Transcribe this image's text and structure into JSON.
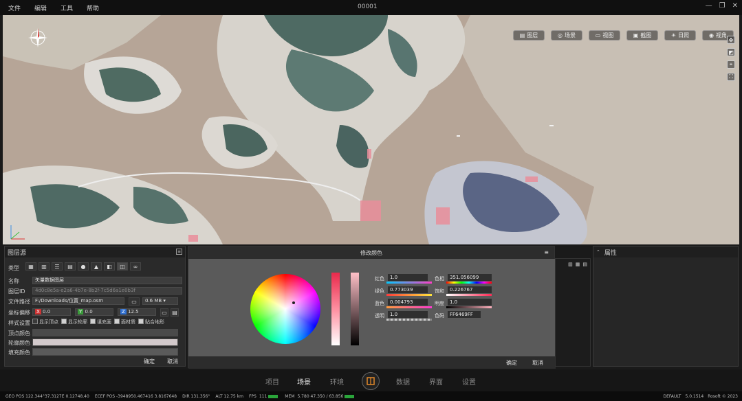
{
  "menu": [
    "文件",
    "编辑",
    "工具",
    "帮助"
  ],
  "window_title": "00001",
  "window_controls": [
    "—",
    "❐",
    "✕"
  ],
  "map_toolbar": [
    {
      "label": "图层",
      "icon": "layers-icon"
    },
    {
      "label": "场景",
      "icon": "scene-icon"
    },
    {
      "label": "视图",
      "icon": "view-icon"
    },
    {
      "label": "截图",
      "icon": "screenshot-icon"
    },
    {
      "label": "日照",
      "icon": "sun-icon"
    },
    {
      "label": "视角",
      "icon": "eye-icon"
    }
  ],
  "layer_panel": {
    "title": "图层源",
    "tab_label": "类型",
    "fields": {
      "name_label": "名称",
      "name_value": "矢量数据图层",
      "id_label": "图层ID",
      "id_value": "4d0c8e5a-e2a6-4b7e-8b2f-7c5d6a1e0b3f",
      "path_label": "文件路径",
      "path_value": "F:/Downloads/位置_map.osm",
      "size_value": "0.6 MB",
      "coord_label": "坐标偏移",
      "coord_x_tag": "X",
      "coord_x": "0.0",
      "coord_y_tag": "Y",
      "coord_y": "0.0",
      "coord_z_tag": "Z",
      "coord_z": "12.5",
      "style_label": "样式设置",
      "style_options": [
        {
          "label": "显示顶点",
          "checked": false
        },
        {
          "label": "显示轮廓",
          "checked": true
        },
        {
          "label": "填充面",
          "checked": true
        },
        {
          "label": "面材质",
          "checked": true
        },
        {
          "label": "贴合地形",
          "checked": true
        }
      ],
      "vertex_color_label": "顶点颜色",
      "outline_color_label": "轮廓颜色",
      "fill_color_label": "填充颜色"
    },
    "confirm": "确定",
    "cancel": "取消"
  },
  "color_dialog": {
    "title": "修改颜色",
    "rows_left": [
      {
        "label": "红色",
        "value": "1.0"
      },
      {
        "label": "绿色",
        "value": "0.773039"
      },
      {
        "label": "蓝色",
        "value": "0.004793"
      },
      {
        "label": "透明",
        "value": "1.0"
      }
    ],
    "rows_right": [
      {
        "label": "色相",
        "value": "351.056099"
      },
      {
        "label": "饱和",
        "value": "0.226767"
      },
      {
        "label": "明度",
        "value": "1.0"
      },
      {
        "label": "色码",
        "value": "FF6469FF"
      }
    ],
    "confirm": "确定",
    "cancel": "取消"
  },
  "props_panel": {
    "title": "属性"
  },
  "bottom_nav": {
    "items": [
      "项目",
      "场景",
      "环境",
      "数据",
      "界面",
      "设置"
    ],
    "active": "场景"
  },
  "status": {
    "geo": "GEO POS 122.344°37.3127E 0.12748.40",
    "ecef": "ECEF POS -3948950.467416 3.8167648",
    "dir": "DIR  131.356°",
    "alt": "ALT  12.75 km",
    "fps_label": "FPS",
    "fps": "111",
    "mem_label": "MEM",
    "mem": "5.780   47.350 / 63.856",
    "default": "DEFAULT",
    "version": "5.0.1514",
    "date": "Rosoft © 2023"
  }
}
